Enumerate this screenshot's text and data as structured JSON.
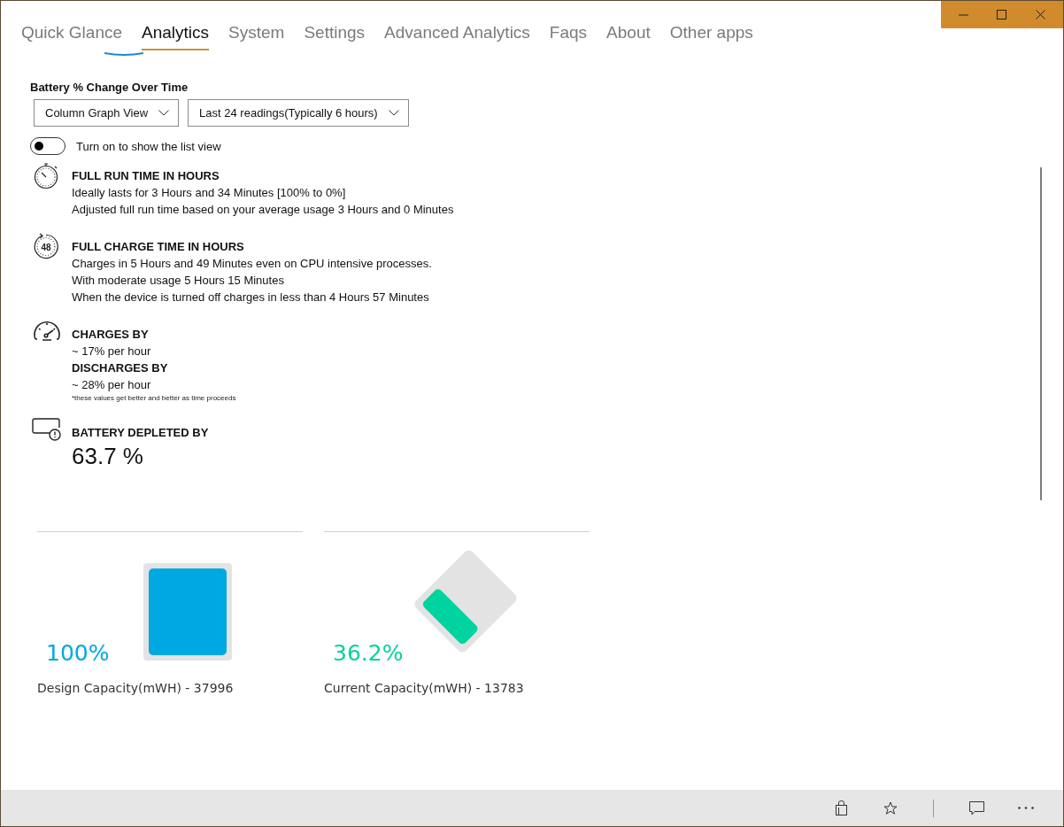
{
  "tabs": [
    {
      "label": "Quick Glance",
      "selected": false
    },
    {
      "label": "Analytics",
      "selected": true
    },
    {
      "label": "System",
      "selected": false
    },
    {
      "label": "Settings",
      "selected": false
    },
    {
      "label": "Advanced Analytics",
      "selected": false
    },
    {
      "label": "Faqs",
      "selected": false
    },
    {
      "label": "About",
      "selected": false
    },
    {
      "label": "Other apps",
      "selected": false
    }
  ],
  "graph_options": {
    "title": "Battery % Change Over Time",
    "dropdowns": [
      {
        "value": "Column Graph View"
      },
      {
        "value": "Last 24 readings(Typically 6 hours)"
      }
    ],
    "toggle": {
      "label": "Turn on to show the list view",
      "on": false
    }
  },
  "sections": [
    {
      "kind": "stopwatch",
      "entries": [
        {
          "kind": "heading",
          "text": "FULL RUN TIME IN HOURS"
        },
        {
          "kind": "line",
          "text": "Ideally lasts for 3 Hours and 34 Minutes [100% to 0%]"
        },
        {
          "kind": "line",
          "text": "Adjusted full run time based on your average usage 3 Hours and 0 Minutes"
        }
      ]
    },
    {
      "kind": "timer",
      "icon_text": "48",
      "entries": [
        {
          "kind": "heading",
          "text": "FULL CHARGE TIME IN HOURS"
        },
        {
          "kind": "line",
          "text": "Charges in 5 Hours and 49 Minutes even on CPU intensive processes."
        },
        {
          "kind": "line",
          "text": "With moderate usage 5 Hours 15 Minutes"
        },
        {
          "kind": "line",
          "text": "When the device is turned off charges in less than 4 Hours 57 Minutes"
        }
      ]
    },
    {
      "kind": "gauge",
      "entries": [
        {
          "kind": "heading",
          "text": "CHARGES  BY"
        },
        {
          "kind": "line",
          "text": "~ 17% per hour"
        },
        {
          "kind": "heading",
          "text": "DISCHARGES  BY"
        },
        {
          "kind": "line",
          "text": "~ 28% per hour"
        },
        {
          "kind": "note",
          "text": "*these values get better and better as time proceeds"
        }
      ]
    },
    {
      "kind": "alert",
      "entries": [
        {
          "kind": "heading",
          "text": "BATTERY DEPLETED BY"
        },
        {
          "kind": "value",
          "text": "63.7 %"
        }
      ]
    }
  ],
  "capacities": [
    {
      "kind": "upright",
      "percent": "100%",
      "label": "Design Capacity(mWH) - 37996",
      "color": "#00a8e1"
    },
    {
      "kind": "tilted",
      "percent": "36.2%",
      "label": "Current Capacity(mWH) - 13783",
      "color": "#00d39f"
    }
  ]
}
